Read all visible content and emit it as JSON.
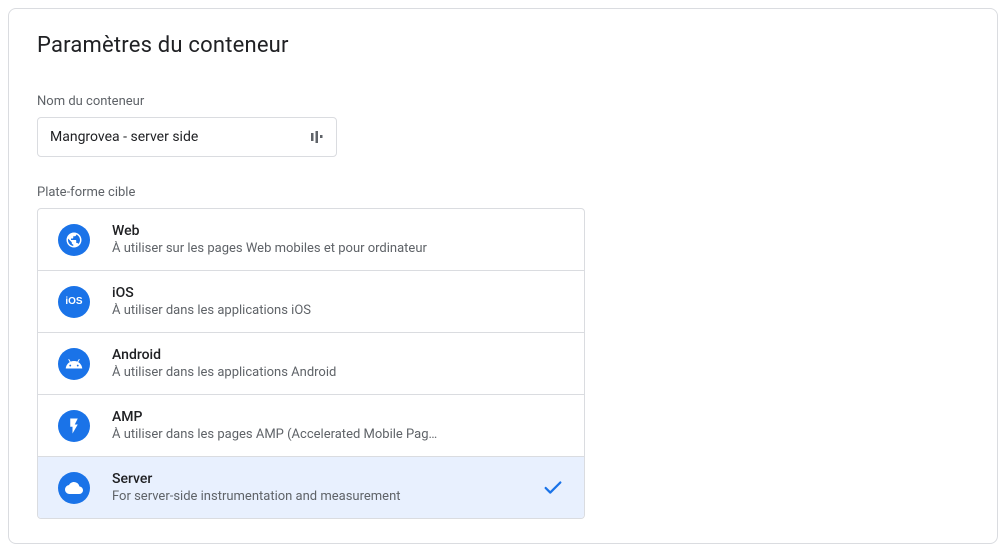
{
  "title": "Paramètres du conteneur",
  "containerName": {
    "label": "Nom du conteneur",
    "value": "Mangrovea - server side"
  },
  "platform": {
    "label": "Plate-forme cible",
    "options": [
      {
        "id": "web",
        "name": "Web",
        "description": "À utiliser sur les pages Web mobiles et pour ordinateur",
        "selected": false
      },
      {
        "id": "ios",
        "name": "iOS",
        "description": "À utiliser dans les applications iOS",
        "selected": false
      },
      {
        "id": "android",
        "name": "Android",
        "description": "À utiliser dans les applications Android",
        "selected": false
      },
      {
        "id": "amp",
        "name": "AMP",
        "description": "À utiliser dans les pages AMP (Accelerated Mobile Pag…",
        "selected": false
      },
      {
        "id": "server",
        "name": "Server",
        "description": "For server-side instrumentation and measurement",
        "selected": true
      }
    ]
  }
}
